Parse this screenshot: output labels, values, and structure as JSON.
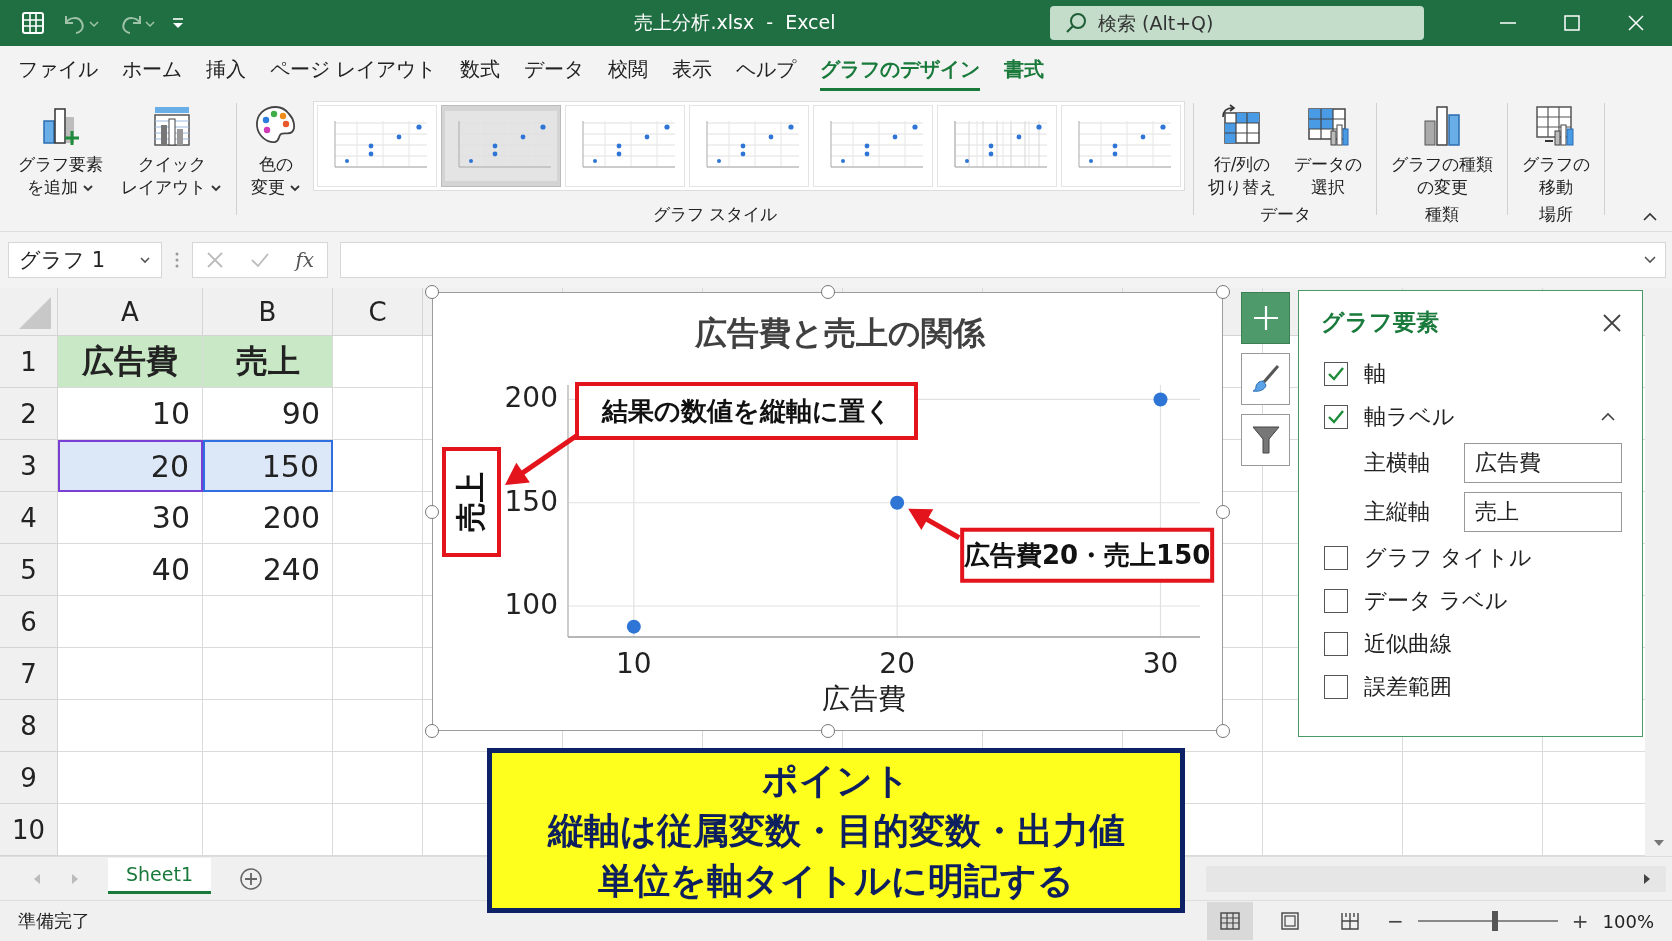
{
  "title_bar": {
    "title": "売上分析.xlsx  -  Excel",
    "search": {
      "placeholder": "検索 (Alt+Q)"
    }
  },
  "menu_tabs": [
    {
      "label": "ファイル",
      "selected": false,
      "contextual": false
    },
    {
      "label": "ホーム",
      "selected": false,
      "contextual": false
    },
    {
      "label": "挿入",
      "selected": false,
      "contextual": false
    },
    {
      "label": "ページ レイアウト",
      "selected": false,
      "contextual": false
    },
    {
      "label": "数式",
      "selected": false,
      "contextual": false
    },
    {
      "label": "データ",
      "selected": false,
      "contextual": false
    },
    {
      "label": "校閲",
      "selected": false,
      "contextual": false
    },
    {
      "label": "表示",
      "selected": false,
      "contextual": false
    },
    {
      "label": "ヘルプ",
      "selected": false,
      "contextual": false
    },
    {
      "label": "グラフのデザイン",
      "selected": true,
      "contextual": true
    },
    {
      "label": "書式",
      "selected": false,
      "contextual": true
    }
  ],
  "ribbon_groups": [
    {
      "buttons": [
        {
          "lines": [
            "グラフ要素",
            "を追加"
          ],
          "kind": "add_element",
          "dropdown": true
        },
        {
          "lines": [
            "クイック",
            "レイアウト"
          ],
          "kind": "quick_layout",
          "dropdown": true
        }
      ]
    },
    {
      "label": "グラフ スタイル",
      "buttons": [
        {
          "lines": [
            "色の",
            "変更"
          ],
          "kind": "palette",
          "dropdown": true
        }
      ],
      "styles": [
        {
          "selected": false
        },
        {
          "selected": true
        },
        {
          "selected": false
        },
        {
          "selected": false
        },
        {
          "selected": false
        },
        {
          "selected": false
        },
        {
          "selected": false
        }
      ]
    },
    {
      "label": "データ",
      "buttons": [
        {
          "lines": [
            "行/列の",
            "切り替え"
          ],
          "kind": "switch",
          "dropdown": false
        },
        {
          "lines": [
            "データの",
            "選択"
          ],
          "kind": "select_data",
          "dropdown": false
        }
      ]
    },
    {
      "label": "種類",
      "buttons": [
        {
          "lines": [
            "グラフの種類",
            "の変更"
          ],
          "kind": "change_type",
          "dropdown": false
        }
      ]
    },
    {
      "label": "場所",
      "buttons": [
        {
          "lines": [
            "グラフの",
            "移動"
          ],
          "kind": "move",
          "dropdown": false
        }
      ]
    }
  ],
  "formula_bar": {
    "name_box": "グラフ 1",
    "function_label": "fx"
  },
  "sheet": {
    "columns": [
      "A",
      "B",
      "C"
    ],
    "rows": [
      {
        "number": "1",
        "kind": "header",
        "selected": false,
        "cells": [
          "広告費",
          "売上"
        ]
      },
      {
        "number": "2",
        "kind": "data",
        "selected": false,
        "cells": [
          "10",
          "90"
        ]
      },
      {
        "number": "3",
        "kind": "data",
        "selected": true,
        "cells": [
          "20",
          "150"
        ]
      },
      {
        "number": "4",
        "kind": "data",
        "selected": false,
        "cells": [
          "30",
          "200"
        ]
      },
      {
        "number": "5",
        "kind": "data",
        "selected": false,
        "cells": [
          "40",
          "240"
        ]
      },
      {
        "number": "6",
        "selected": false
      },
      {
        "number": "7",
        "selected": false
      },
      {
        "number": "8",
        "selected": false
      },
      {
        "number": "9",
        "selected": false
      },
      {
        "number": "10",
        "selected": false
      }
    ]
  },
  "chart": {
    "chart_data": {
      "type": "scatter",
      "title": "広告費と売上の関係",
      "xlabel": "広告費",
      "ylabel": "売上",
      "x": [
        10,
        20,
        30
      ],
      "series": [
        {
          "color": "#2e75d6",
          "values": [
            90,
            150,
            200
          ]
        }
      ],
      "xlim": [
        7.5,
        31.5
      ],
      "ylim": [
        85,
        207
      ],
      "grid": true,
      "xticks": [
        {
          "value": 10,
          "label": "10"
        },
        {
          "value": 20,
          "label": "20"
        },
        {
          "value": 30,
          "label": "30"
        }
      ],
      "yticks": [
        {
          "value": 100,
          "label": "100"
        },
        {
          "value": 150,
          "label": "150"
        },
        {
          "value": 200,
          "label": "200"
        }
      ],
      "annotations": [
        {
          "text": "結果の数値を縦軸に置く"
        },
        {
          "text": "広告費20・売上150",
          "x": 20,
          "y": 150
        }
      ]
    }
  },
  "chart_tools": [
    {
      "kind": "plus",
      "selected": true
    },
    {
      "kind": "brush",
      "selected": false
    },
    {
      "kind": "filter",
      "selected": false
    }
  ],
  "elements_panel": {
    "title": "グラフ要素",
    "items": [
      {
        "label": "軸",
        "checked": true,
        "expanded": false
      },
      {
        "label": "軸ラベル",
        "checked": true,
        "expanded": true,
        "fields": [
          {
            "label": "主横軸",
            "value": "広告費"
          },
          {
            "label": "主縦軸",
            "value": "売上"
          }
        ]
      },
      {
        "label": "グラフ タイトル",
        "checked": false,
        "expanded": false
      },
      {
        "label": "データ ラベル",
        "checked": false,
        "expanded": false
      },
      {
        "label": "近似曲線",
        "checked": false,
        "expanded": false
      },
      {
        "label": "誤差範囲",
        "checked": false,
        "expanded": false
      }
    ]
  },
  "note": {
    "title": "ポイント",
    "lines": [
      "縦軸は従属変数・目的変数・出力値",
      "単位を軸タイトルに明記する"
    ]
  },
  "sheet_tabs": [
    {
      "label": "Sheet1",
      "selected": true
    }
  ],
  "status_bar": {
    "text": "準備完了",
    "views": [
      {
        "kind": "normal",
        "selected": true
      },
      {
        "kind": "page_layout",
        "selected": false
      },
      {
        "kind": "page_break",
        "selected": false
      }
    ],
    "zoom": {
      "minus": "−",
      "plus": "+",
      "level": 0.55,
      "reading": "100%"
    }
  }
}
